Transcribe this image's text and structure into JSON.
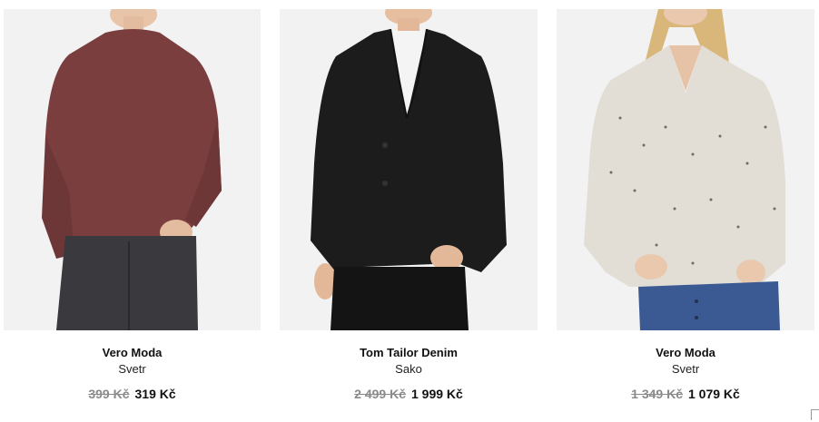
{
  "products": [
    {
      "brand": "Vero Moda",
      "type": "Svetr",
      "old_price": "399 Kč",
      "new_price": "319 Kč",
      "garment_color": "#7a3e3e"
    },
    {
      "brand": "Tom Tailor Denim",
      "type": "Sako",
      "old_price": "2 499 Kč",
      "new_price": "1 999 Kč",
      "garment_color": "#1c1c1c"
    },
    {
      "brand": "Vero Moda",
      "type": "Svetr",
      "old_price": "1 349 Kč",
      "new_price": "1 079 Kč",
      "garment_color": "#e2ded6"
    }
  ],
  "colors": {
    "image_background": "#f2f2f2",
    "old_price": "#8a8a8a",
    "text": "#111111"
  }
}
